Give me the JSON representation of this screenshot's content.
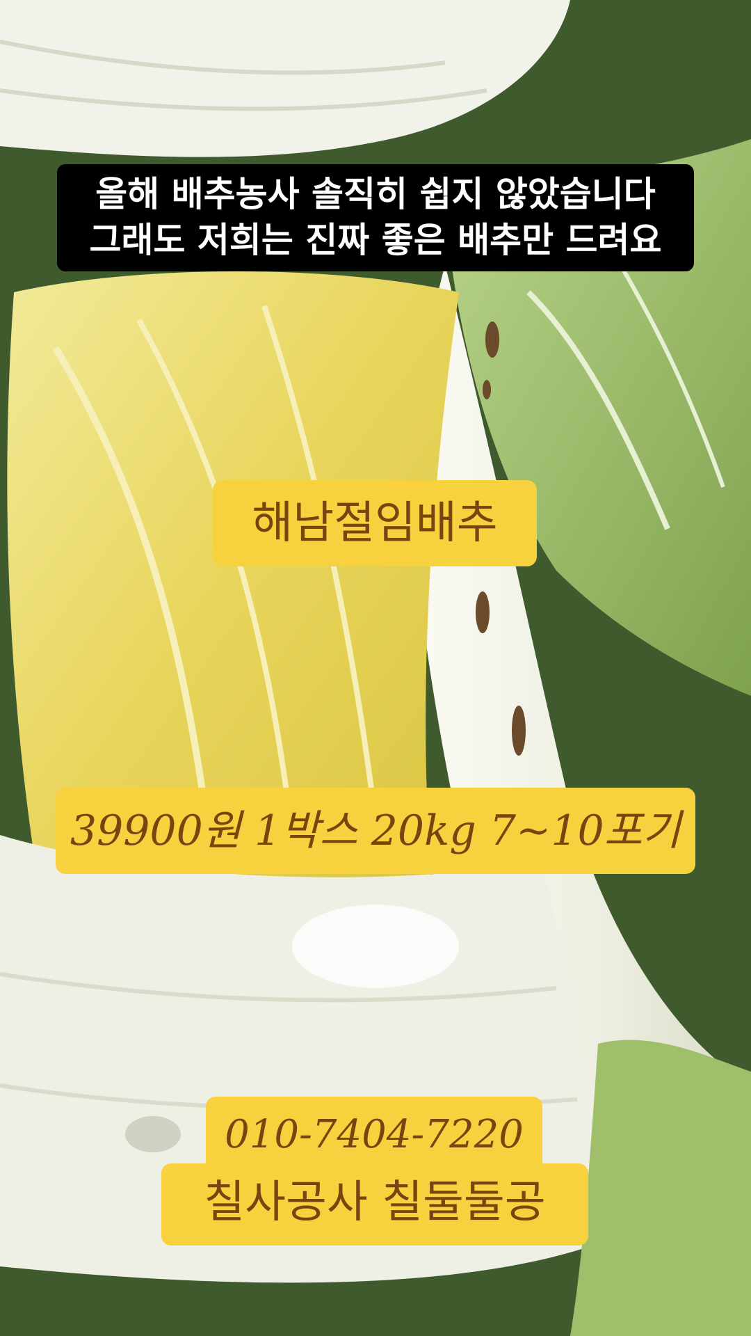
{
  "caption": {
    "line1": "올해 배추농사 솔직히 쉽지 않았습니다",
    "line2": "그래도 저희는 진짜 좋은 배추만 드려요"
  },
  "product_tag": "해남절임배추",
  "price_tag": "39900원 1박스 20kg 7~10포기",
  "contact": {
    "phone": "010-7404-7220",
    "mnemonic": "칠사공사 칠둘둘공"
  },
  "colors": {
    "tag_background": "#f7d23e",
    "tag_text": "#7a4410",
    "caption_background": "#000000",
    "caption_text": "#ffffff"
  }
}
